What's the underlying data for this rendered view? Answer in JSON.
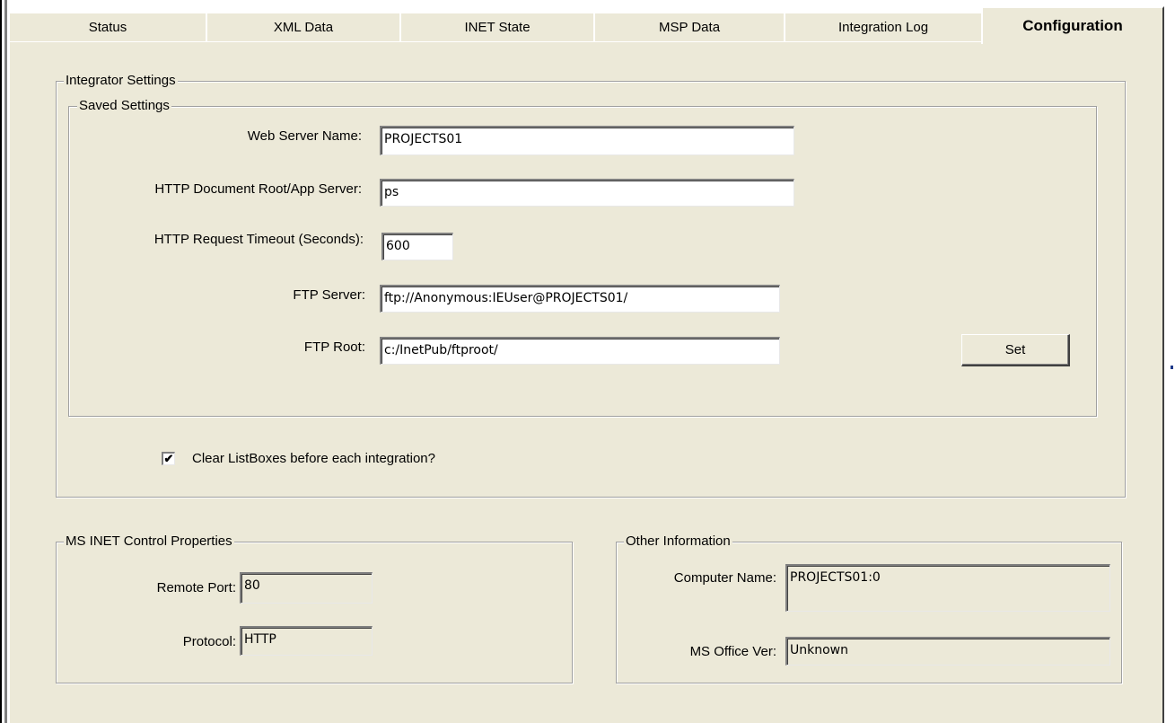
{
  "tabs": [
    {
      "label": "Status"
    },
    {
      "label": "XML Data"
    },
    {
      "label": "INET State"
    },
    {
      "label": "MSP Data"
    },
    {
      "label": "Integration Log"
    },
    {
      "label": "Configuration",
      "active": true
    }
  ],
  "integrator": {
    "title": "Integrator Settings",
    "saved": {
      "title": "Saved Settings",
      "web_server_label": "Web Server Name:",
      "web_server_value": "PROJECTS01",
      "doc_root_label": "HTTP Document Root/App Server:",
      "doc_root_value": "ps",
      "timeout_label": "HTTP Request Timeout (Seconds):",
      "timeout_value": "600",
      "ftp_server_label": "FTP Server:",
      "ftp_server_value": "ftp://Anonymous:IEUser@PROJECTS01/",
      "ftp_root_label": "FTP Root:",
      "ftp_root_value": "c:/InetPub/ftproot/",
      "set_button": "Set"
    },
    "clear_checkbox_label": "Clear ListBoxes before each integration?",
    "clear_checkbox_checked": true,
    "check_glyph": "✔"
  },
  "inet": {
    "title": "MS INET Control Properties",
    "remote_port_label": "Remote Port:",
    "remote_port_value": "80",
    "protocol_label": "Protocol:",
    "protocol_value": "HTTP"
  },
  "other": {
    "title": "Other Information",
    "computer_name_label": "Computer Name:",
    "computer_name_value": "PROJECTS01:0",
    "office_ver_label": "MS Office Ver:",
    "office_ver_value": "Unknown"
  }
}
